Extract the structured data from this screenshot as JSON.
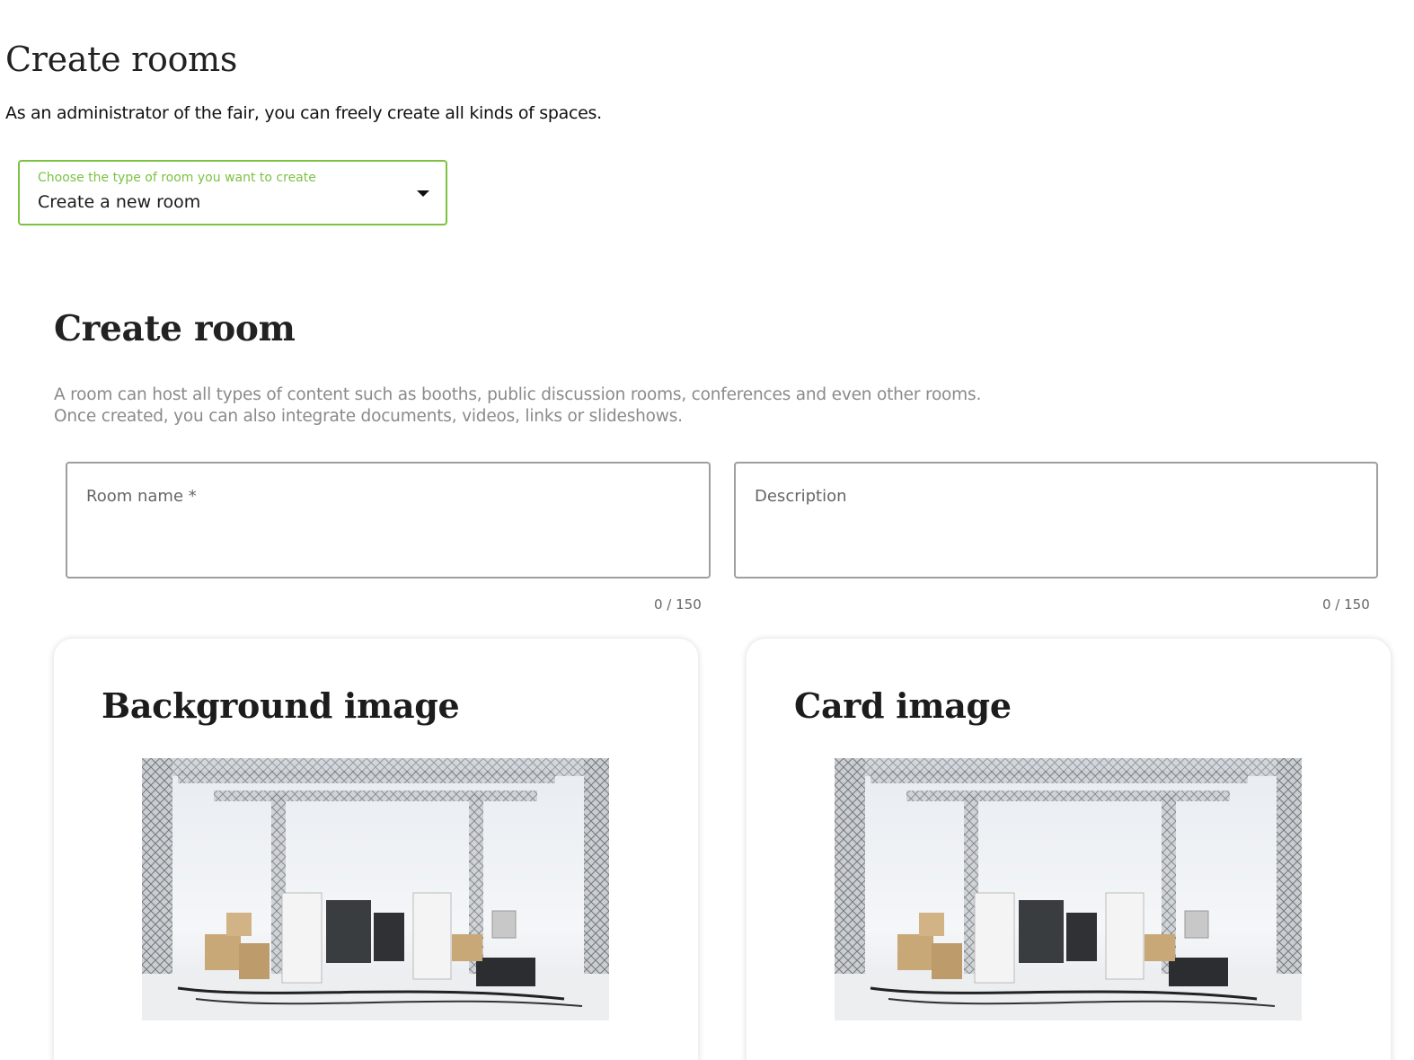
{
  "page": {
    "title": "Create rooms",
    "subtitle": "As an administrator of the fair, you can freely create all kinds of spaces."
  },
  "room_type_select": {
    "label": "Choose the type of room you want to create",
    "value": "Create a new room",
    "accent_color": "#7cc242"
  },
  "create_room": {
    "title": "Create room",
    "description_lines": [
      "A room can host all types of content such as booths, public discussion rooms, conferences and even other rooms.",
      "Once created, you can also integrate documents, videos, links or slideshows."
    ],
    "fields": {
      "room_name": {
        "label": "Room name *",
        "value": "",
        "counter": "0 / 150"
      },
      "description": {
        "label": "Description",
        "value": "",
        "counter": "0 / 150"
      }
    }
  },
  "cards": {
    "background_image": {
      "title": "Background image",
      "image": "empty-exhibition-stage-with-trusses-and-flight-cases"
    },
    "card_image": {
      "title": "Card image",
      "image": "empty-exhibition-stage-with-trusses-and-flight-cases"
    }
  }
}
